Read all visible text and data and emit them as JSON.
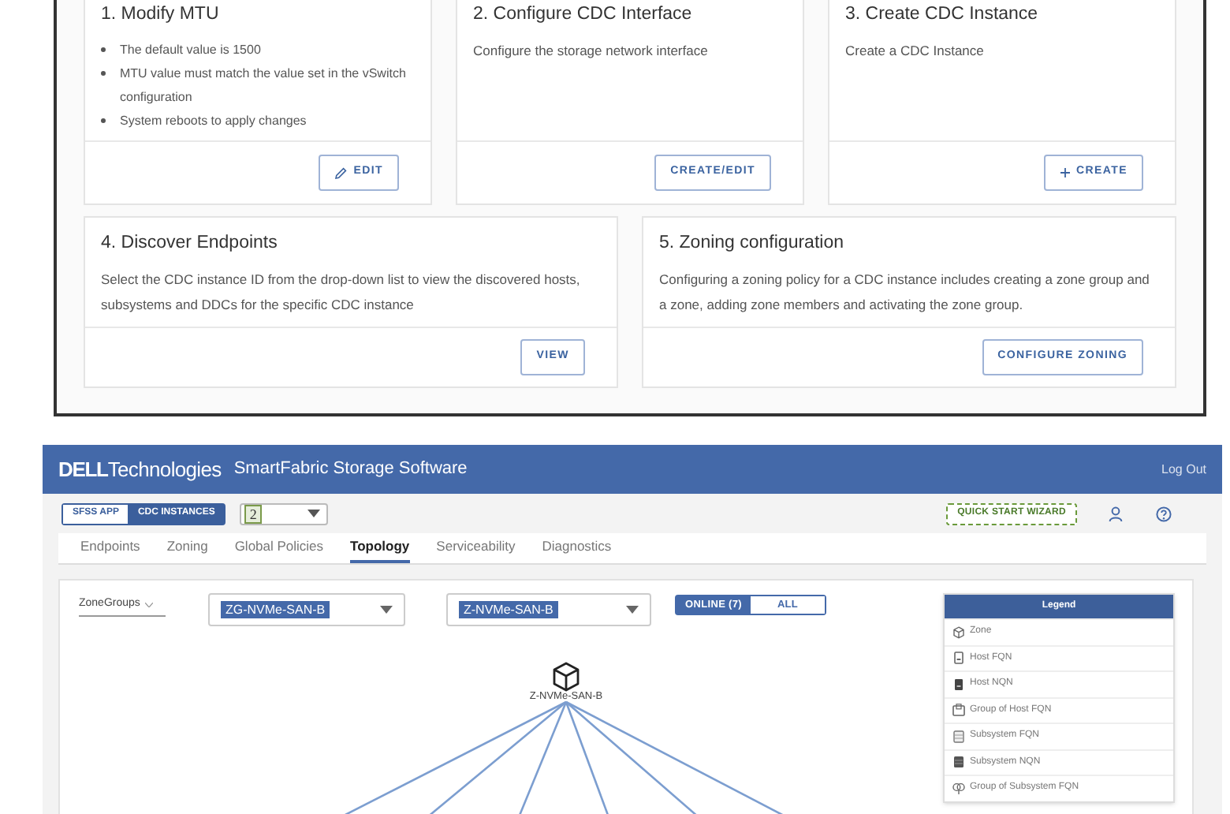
{
  "steps": {
    "row1": [
      {
        "title": "1. Modify MTU",
        "bullets": [
          "The default value is 1500",
          "MTU value must match the value set in the vSwitch configuration",
          "System reboots to apply changes"
        ],
        "button": {
          "label": "EDIT",
          "kind": "edit"
        }
      },
      {
        "title": "2. Configure CDC Interface",
        "text": "Configure the storage network interface",
        "button": {
          "label": "CREATE/EDIT"
        }
      },
      {
        "title": "3. Create CDC Instance",
        "text": "Create a CDC Instance",
        "button": {
          "label": "CREATE",
          "kind": "create"
        }
      }
    ],
    "row2": [
      {
        "title": "4. Discover Endpoints",
        "text": "Select the CDC instance ID from the drop-down list to view the discovered hosts, subsystems and DDCs for the specific CDC instance",
        "button": {
          "label": "VIEW"
        }
      },
      {
        "title": "5. Zoning configuration",
        "text": "Configuring a zoning policy for a CDC instance includes creating a zone group and a zone, adding zone members and activating the zone group.",
        "button": {
          "label": "CONFIGURE ZONING"
        }
      }
    ]
  },
  "app": {
    "brand_bold": "DELL",
    "brand_light": "Technologies",
    "title": "SmartFabric Storage Software",
    "logout": "Log Out",
    "modes": [
      {
        "label": "SFSS APP",
        "selected": false
      },
      {
        "label": "CDC INSTANCES",
        "selected": true
      }
    ],
    "instance_select": {
      "value": "2"
    },
    "wizard_button": "QUICK START WIZARD",
    "tabs": [
      {
        "label": "Endpoints",
        "selected": false
      },
      {
        "label": "Zoning",
        "selected": false
      },
      {
        "label": "Global Policies",
        "selected": false
      },
      {
        "label": "Topology",
        "selected": true
      },
      {
        "label": "Serviceability",
        "selected": false
      },
      {
        "label": "Diagnostics",
        "selected": false
      }
    ],
    "topology": {
      "view_select": "ZoneGroups",
      "zone_group_select": "ZG-NVMe-SAN-B",
      "zone_select": "Z-NVMe-SAN-B",
      "filter": [
        {
          "label": "ONLINE (7)",
          "selected": true
        },
        {
          "label": "ALL",
          "selected": false
        }
      ],
      "node_label": "Z-NVMe-SAN-B",
      "legend": {
        "title": "Legend",
        "items": [
          {
            "kind": "zone",
            "label": "Zone"
          },
          {
            "kind": "host-fqn",
            "label": "Host FQN"
          },
          {
            "kind": "host-nqn",
            "label": "Host NQN"
          },
          {
            "kind": "host-group",
            "label": "Group of Host FQN"
          },
          {
            "kind": "subsystem-fqn",
            "label": "Subsystem FQN"
          },
          {
            "kind": "subsystem-nqn",
            "label": "Subsystem NQN"
          },
          {
            "kind": "subsystem-group",
            "label": "Group of Subsystem FQN"
          }
        ]
      }
    }
  }
}
